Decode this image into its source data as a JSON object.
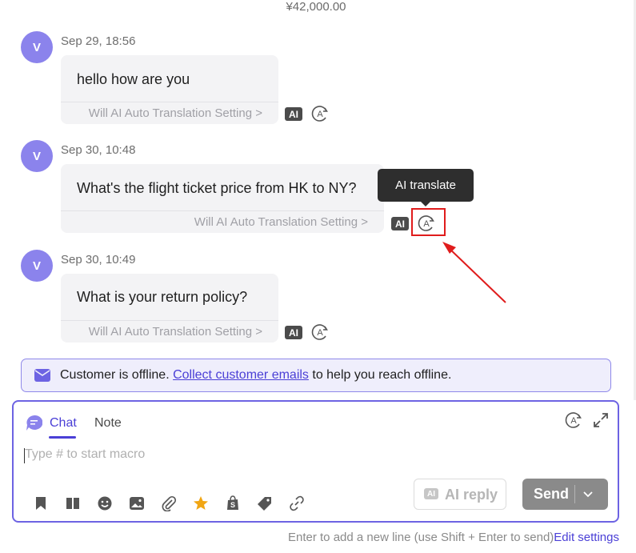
{
  "header": {
    "price": "¥42,000.00"
  },
  "messages": [
    {
      "avatar": "V",
      "time": "Sep 29, 18:56",
      "text": "hello how are you",
      "translation_link": "Will AI Auto Translation Setting >",
      "ai_badge": "AI"
    },
    {
      "avatar": "V",
      "time": "Sep 30, 10:48",
      "text": "What's the flight ticket price from HK to NY?",
      "translation_link": "Will AI Auto Translation Setting >",
      "ai_badge": "AI"
    },
    {
      "avatar": "V",
      "time": "Sep 30, 10:49",
      "text": "What is your return policy?",
      "translation_link": "Will AI Auto Translation Setting >",
      "ai_badge": "AI"
    }
  ],
  "tooltip": {
    "label": "AI translate"
  },
  "offline_banner": {
    "prefix": "Customer is offline. ",
    "link": "Collect customer emails",
    "suffix": " to help you reach offline."
  },
  "composer": {
    "tabs": [
      "Chat",
      "Note"
    ],
    "active_tab": "Chat",
    "placeholder": "Type # to start macro",
    "ai_reply_badge": "AI",
    "ai_reply_label": "AI reply",
    "send_label": "Send",
    "toolbar_icons": [
      "bookmark-icon",
      "knowledge-book-icon",
      "emoji-icon",
      "image-icon",
      "attachment-icon",
      "star-icon",
      "shopify-icon",
      "tag-icon",
      "link-icon"
    ]
  },
  "footer": {
    "hint": "Enter to add a new line (use Shift + Enter to send)",
    "link": "Edit settings"
  },
  "colors": {
    "accent": "#4a3fd6",
    "avatar": "#8b83ec",
    "highlight": "#e01c1c",
    "banner_bg": "#efeefc"
  }
}
